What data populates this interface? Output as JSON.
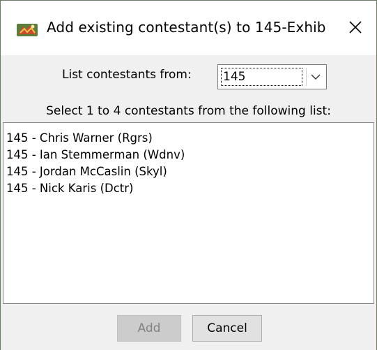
{
  "window": {
    "title": "Add existing contestant(s) to 145-Exhib",
    "icon": "app-icon",
    "close_icon": "close-icon"
  },
  "list_from": {
    "label": "List contestants from:",
    "selected": "145"
  },
  "instruction": "Select 1 to 4 contestants from the following list:",
  "contestants": [
    "145 - Chris Warner (Rgrs)",
    "145 - Ian Stemmerman (Wdnv)",
    "145 - Jordan McCaslin (Skyl)",
    "145 - Nick Karis (Dctr)"
  ],
  "buttons": {
    "add_label": "Add",
    "add_enabled": false,
    "cancel_label": "Cancel"
  }
}
